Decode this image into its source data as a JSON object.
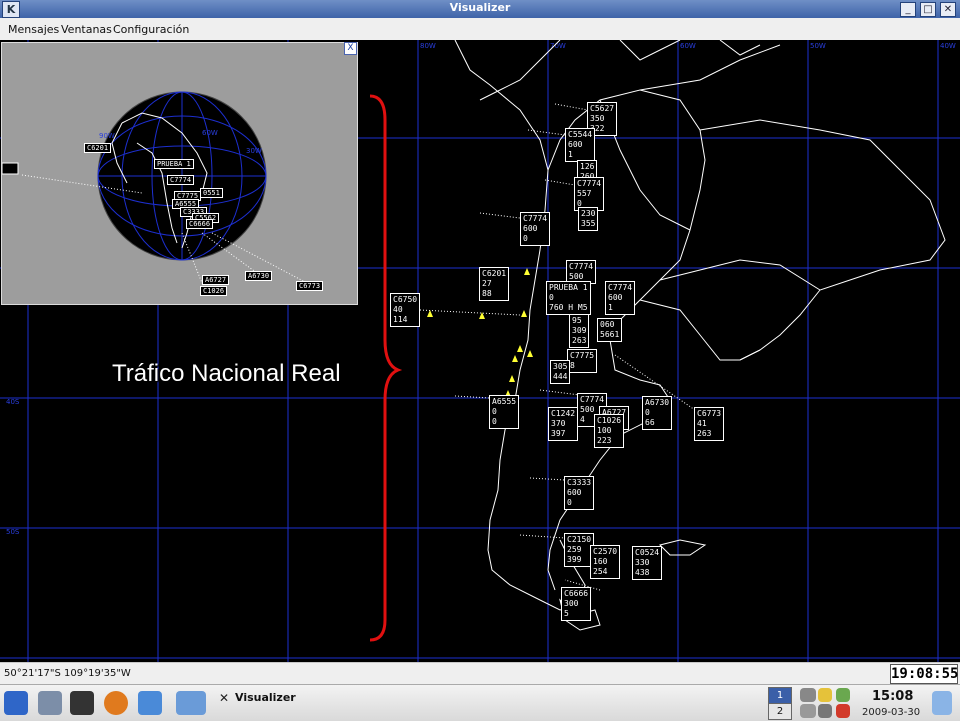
{
  "window": {
    "title": "Visualizer",
    "kde_button": "K",
    "min_label": "_",
    "max_label": "□",
    "close_label": "✕"
  },
  "menu": {
    "items": [
      "Mensajes",
      "Ventanas",
      "Configuración"
    ]
  },
  "map": {
    "meridian_labels": [
      "80W",
      "70W",
      "60W",
      "50W",
      "40W"
    ],
    "parallel_labels": [
      "40S",
      "50S"
    ],
    "aircraft": [
      {
        "lines": [
          "C5627",
          "350",
          "322"
        ]
      },
      {
        "lines": [
          "C5544",
          "600",
          "1"
        ]
      },
      {
        "lines": [
          "126",
          "260"
        ]
      },
      {
        "lines": [
          "C7774",
          "557",
          "0"
        ]
      },
      {
        "lines": [
          "230",
          "355"
        ]
      },
      {
        "lines": [
          "C7774",
          "600",
          "0"
        ]
      },
      {
        "lines": [
          "C6201",
          "27",
          "88"
        ]
      },
      {
        "lines": [
          "C7774",
          "500"
        ]
      },
      {
        "lines": [
          "C7774",
          "600",
          "1"
        ]
      },
      {
        "lines": [
          "PRUEBA 1",
          "0",
          "760 H M5"
        ]
      },
      {
        "lines": [
          "95",
          "309",
          "263"
        ]
      },
      {
        "lines": [
          "060",
          "5661"
        ]
      },
      {
        "lines": [
          "C6750",
          "40",
          "114"
        ]
      },
      {
        "lines": [
          "C7775",
          "8"
        ]
      },
      {
        "lines": [
          "305",
          "444"
        ]
      },
      {
        "lines": [
          "A6555",
          "0",
          "0"
        ]
      },
      {
        "lines": [
          "C1242",
          "370",
          "397"
        ]
      },
      {
        "lines": [
          "C7774",
          "500",
          "4"
        ]
      },
      {
        "lines": [
          "A6727",
          "215"
        ]
      },
      {
        "lines": [
          "C1026",
          "100",
          "223"
        ]
      },
      {
        "lines": [
          "A6730",
          "0",
          "66"
        ]
      },
      {
        "lines": [
          "C6773",
          "41",
          "263"
        ]
      },
      {
        "lines": [
          "C3333",
          "600",
          "0"
        ]
      },
      {
        "lines": [
          "C2150",
          "259",
          "399"
        ]
      },
      {
        "lines": [
          "C2570",
          "160",
          "254"
        ]
      },
      {
        "lines": [
          "C0524",
          "330",
          "438"
        ]
      },
      {
        "lines": [
          "C6666",
          "300",
          "5"
        ]
      }
    ],
    "annotation": "Tráfico Nacional Real"
  },
  "inset": {
    "close_label": "X",
    "labels": [
      "C6201",
      "PRUEBA 1",
      "C7774",
      "C7775",
      "0551",
      "A6555",
      "C3333",
      "C5562",
      "C6666",
      "A6730",
      "A6727",
      "C1026",
      "C6773"
    ],
    "grid_labels": [
      "90W",
      "60W",
      "30W"
    ]
  },
  "status": {
    "coordinates": "50°21'17\"S 109°19'35\"W",
    "clock": "19:08:55"
  },
  "taskbar": {
    "task_label": "Visualizer",
    "pager": [
      "1",
      "2"
    ],
    "time": "15:08",
    "date": "2009-03-30"
  },
  "colors": {
    "map_bg": "#000000",
    "grid": "#1d2fd0",
    "coast": "#ffffff",
    "annotation_brace": "#e01010",
    "aircraft": "#ffff33"
  }
}
